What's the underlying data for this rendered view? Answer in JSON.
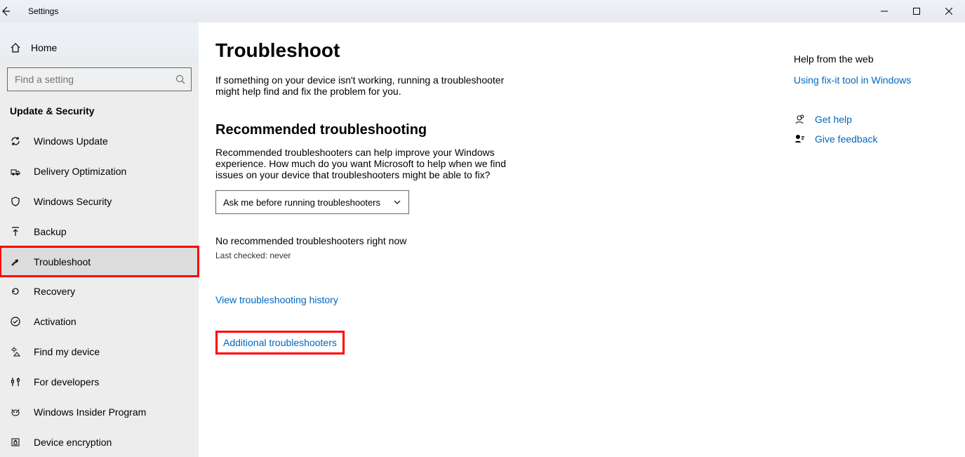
{
  "titlebar": {
    "title": "Settings"
  },
  "sidebar": {
    "home_label": "Home",
    "search_placeholder": "Find a setting",
    "section_title": "Update & Security",
    "items": [
      {
        "icon": "sync-icon",
        "label": "Windows Update"
      },
      {
        "icon": "delivery-icon",
        "label": "Delivery Optimization"
      },
      {
        "icon": "shield-icon",
        "label": "Windows Security"
      },
      {
        "icon": "backup-icon",
        "label": "Backup"
      },
      {
        "icon": "wrench-icon",
        "label": "Troubleshoot"
      },
      {
        "icon": "recovery-icon",
        "label": "Recovery"
      },
      {
        "icon": "check-icon",
        "label": "Activation"
      },
      {
        "icon": "location-icon",
        "label": "Find my device"
      },
      {
        "icon": "dev-icon",
        "label": "For developers"
      },
      {
        "icon": "insider-icon",
        "label": "Windows Insider Program"
      },
      {
        "icon": "encrypt-icon",
        "label": "Device encryption"
      }
    ]
  },
  "main": {
    "title": "Troubleshoot",
    "intro": "If something on your device isn't working, running a troubleshooter might help find and fix the problem for you.",
    "rec_heading": "Recommended troubleshooting",
    "rec_desc": "Recommended troubleshooters can help improve your Windows experience. How much do you want Microsoft to help when we find issues on your device that troubleshooters might be able to fix?",
    "dropdown_value": "Ask me before running troubleshooters",
    "status_none": "No recommended troubleshooters right now",
    "status_checked": "Last checked: never",
    "link_history": "View troubleshooting history",
    "link_additional": "Additional troubleshooters"
  },
  "right": {
    "heading": "Help from the web",
    "link_fixit": "Using fix-it tool in Windows",
    "get_help": "Get help",
    "give_feedback": "Give feedback"
  }
}
